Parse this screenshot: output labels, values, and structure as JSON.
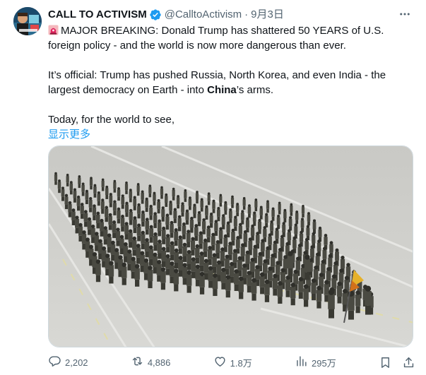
{
  "author": {
    "name": "CALL TO ACTIVISM",
    "handle": "@CalltoActivism",
    "separator": "·",
    "date": "9月3日"
  },
  "text": {
    "line1": "MAJOR BREAKING: Donald Trump has shattered 50 YEARS of U.S. foreign policy - and the world is now more dangerous than ever.",
    "p2_before": "It’s official: Trump has pushed Russia, North Korea, and even India - the largest democracy on Earth - into ",
    "p2_bold": "China",
    "p2_after": "’s arms.",
    "p3": "Today, for the world to see,",
    "show_more": "显示更多"
  },
  "actions": {
    "replies": "2,202",
    "reposts": "4,886",
    "likes": "1.8万",
    "views": "295万"
  },
  "icons": {
    "emoji": "police-car-light-icon",
    "verified": "verified-badge-icon",
    "more": "more-icon",
    "reply": "reply-icon",
    "repost": "repost-icon",
    "like": "heart-icon",
    "views": "views-icon",
    "bookmark": "bookmark-icon",
    "share": "share-icon"
  },
  "colors": {
    "link": "#1d9bf0",
    "muted": "#536471",
    "verified": "#1d9bf0",
    "text": "#0f1419"
  }
}
